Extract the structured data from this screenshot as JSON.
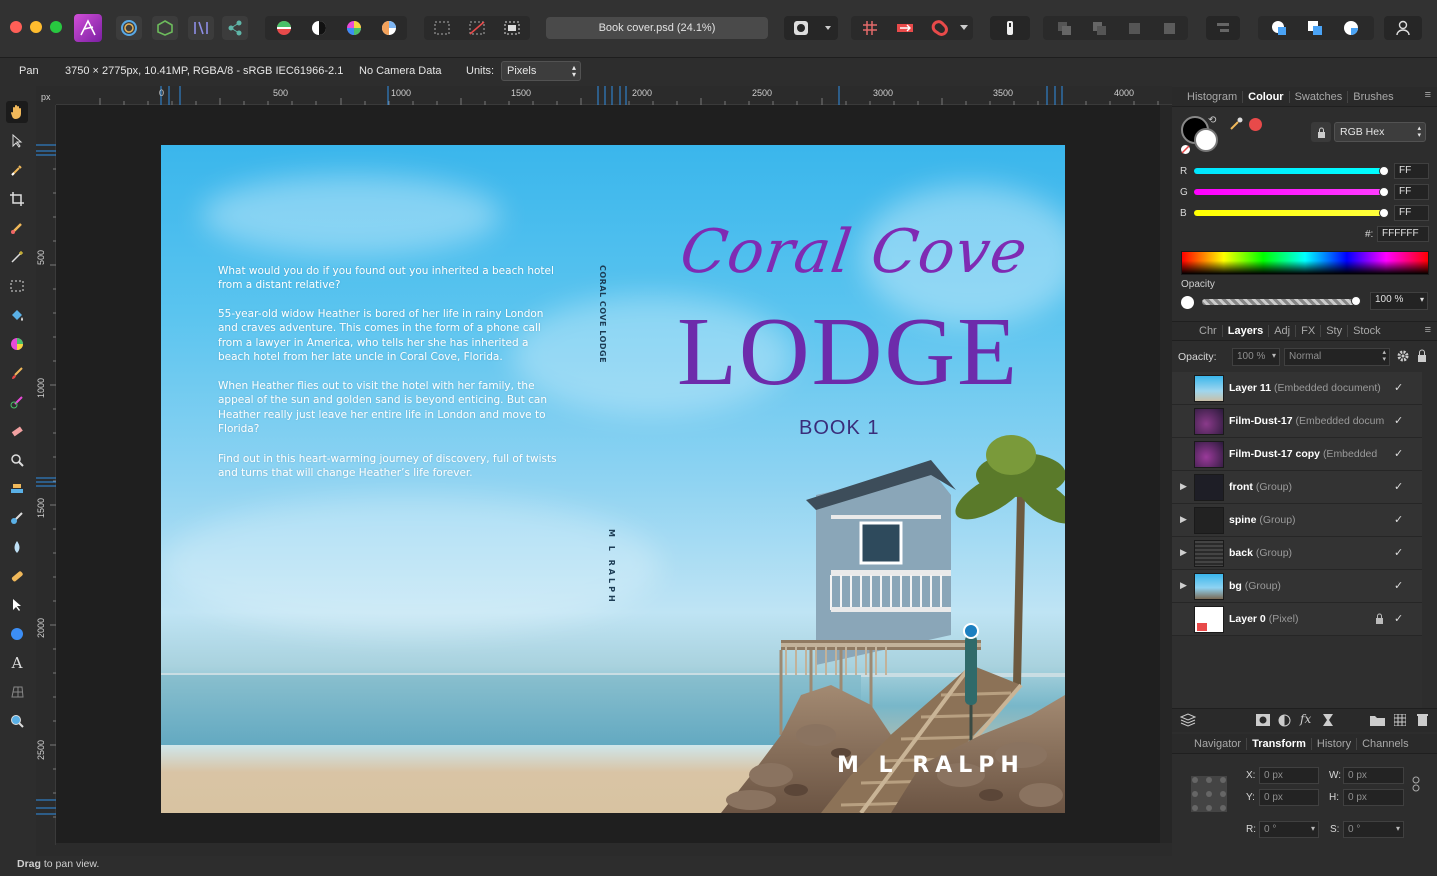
{
  "app": {
    "document_title": "Book cover.psd (24.1%)"
  },
  "context_bar": {
    "tool_name": "Pan",
    "doc_info": "3750 × 2775px, 10.41MP, RGBA/8 - sRGB IEC61966-2.1",
    "camera": "No Camera Data",
    "units_label": "Units:",
    "units_value": "Pixels"
  },
  "ruler": {
    "unit": "px",
    "h_ticks": [
      "0",
      "500",
      "1000",
      "1500",
      "2000",
      "2500",
      "3000",
      "3500",
      "4000"
    ],
    "v_ticks": [
      "500",
      "1000",
      "1500",
      "2000",
      "2500"
    ]
  },
  "cover": {
    "blurb": [
      "What would you do if you found out you inherited a beach hotel from a distant relative?",
      "55-year-old widow Heather is bored of her life in rainy London and craves adventure. This comes in the form of a phone call from a lawyer in America, who tells her she has inherited a beach hotel from her late uncle in Coral Cove, Florida.",
      "When Heather flies out to visit the hotel with her family, the appeal of the sun and golden sand is beyond enticing. But can Heather really just leave her entire life in London and move to Florida?",
      "Find out in this heart-warming journey of discovery, full of twists and turns that will change Heather’s life forever."
    ],
    "spine_title": "CORAL COVE LODGE",
    "spine_author": "M L RALPH",
    "title_script": "Coral Cove",
    "title_main": "LODGE",
    "book_label": "BOOK 1",
    "author": "M L RALPH"
  },
  "colour_panel": {
    "tabs": [
      "Histogram",
      "Colour",
      "Swatches",
      "Brushes"
    ],
    "active_tab": "Colour",
    "mode": "RGB Hex",
    "r_label": "R",
    "r_value": "FF",
    "g_label": "G",
    "g_value": "FF",
    "b_label": "B",
    "b_value": "FF",
    "hex_label": "#:",
    "hex_value": "FFFFFF",
    "opacity_label": "Opacity",
    "opacity_value": "100 %",
    "colors": {
      "primary": "#000000",
      "secondary": "#ffffff",
      "swatch_red": "#e84a4a"
    }
  },
  "layers_panel": {
    "tabs": [
      "Chr",
      "Layers",
      "Adj",
      "FX",
      "Sty",
      "Stock"
    ],
    "active_tab": "Layers",
    "opacity_label": "Opacity:",
    "opacity_value": "100 %",
    "blend_mode": "Normal",
    "layers": [
      {
        "name": "Layer 11",
        "type": "(Embedded document)"
      },
      {
        "name": "Film-Dust-17",
        "type": "(Embedded docum"
      },
      {
        "name": "Film-Dust-17 copy",
        "type": "(Embedded"
      },
      {
        "name": "front",
        "type": "(Group)"
      },
      {
        "name": "spine",
        "type": "(Group)"
      },
      {
        "name": "back",
        "type": "(Group)"
      },
      {
        "name": "bg",
        "type": "(Group)"
      },
      {
        "name": "Layer 0",
        "type": "(Pixel)"
      }
    ]
  },
  "transform_panel": {
    "tabs": [
      "Navigator",
      "Transform",
      "History",
      "Channels"
    ],
    "active_tab": "Transform",
    "x_label": "X:",
    "x_value": "0 px",
    "y_label": "Y:",
    "y_value": "0 px",
    "w_label": "W:",
    "w_value": "0 px",
    "h_label": "H:",
    "h_value": "0 px",
    "r_label": "R:",
    "r_value": "0 °",
    "s_label": "S:",
    "s_value": "0 °"
  },
  "status_bar": {
    "bold": "Drag",
    "text": " to pan view."
  }
}
